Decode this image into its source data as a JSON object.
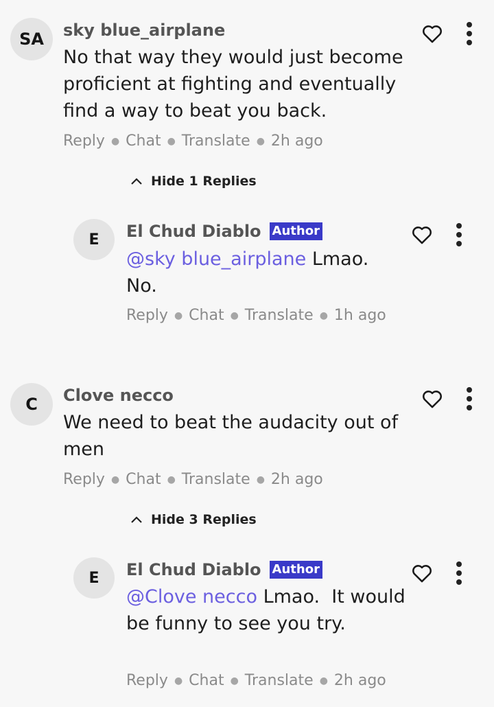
{
  "comments": [
    {
      "avatar": "SA",
      "name": "sky blue_airplane",
      "text": "No that way they would just become proficient at fighting and eventually find a way to beat you back.",
      "actions": {
        "reply": "Reply",
        "chat": "Chat",
        "translate": "Translate",
        "time": "2h ago"
      },
      "toggle": "Hide 1 Replies",
      "reply": {
        "avatar": "E",
        "name": "El Chud Diablo",
        "badge": "Author",
        "mention": "@sky blue_airplane",
        "text_line1": " Lmao.",
        "text_line2": "No.",
        "actions": {
          "reply": "Reply",
          "chat": "Chat",
          "translate": "Translate",
          "time": "1h ago"
        }
      }
    },
    {
      "avatar": "C",
      "name": "Clove necco",
      "text": "We need to beat the audacity out of men",
      "actions": {
        "reply": "Reply",
        "chat": "Chat",
        "translate": "Translate",
        "time": "2h ago"
      },
      "toggle": "Hide 3 Replies",
      "reply": {
        "avatar": "E",
        "name": "El Chud Diablo",
        "badge": "Author",
        "mention": "@Clove necco",
        "text_line1": " Lmao.  It would",
        "text_line2": "be funny to see you try.",
        "actions": {
          "reply": "Reply",
          "chat": "Chat",
          "translate": "Translate",
          "time": "2h ago"
        }
      }
    }
  ],
  "icons": {
    "like": "heart-outline-icon",
    "more": "more-vertical-icon",
    "collapse": "chevron-up-icon"
  },
  "colors": {
    "author_badge": "#3a3ac8",
    "mention": "#6b5fe0",
    "background": "#f7f7f7"
  }
}
